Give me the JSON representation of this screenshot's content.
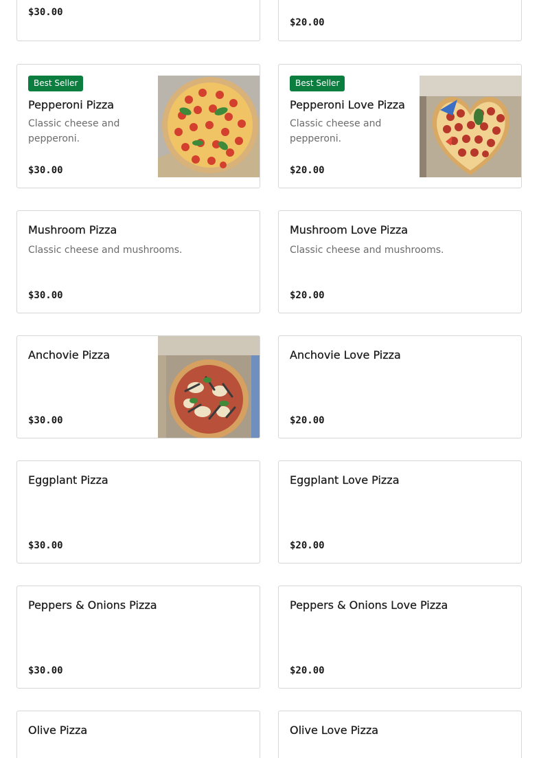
{
  "items": [
    {
      "price": "$30.00"
    },
    {
      "price": "$20.00"
    },
    {
      "badge": "Best Seller",
      "name": "Pepperoni Pizza",
      "desc": "Classic cheese and pepperoni.",
      "price": "$30.00",
      "image": "pepperoni-pizza-photo"
    },
    {
      "badge": "Best Seller",
      "name": "Pepperoni Love Pizza",
      "desc": "Classic cheese and pepperoni.",
      "price": "$20.00",
      "image": "heart-pepperoni-pizza-photo"
    },
    {
      "name": "Mushroom Pizza",
      "desc": "Classic cheese and mushrooms.",
      "price": "$30.00"
    },
    {
      "name": "Mushroom Love Pizza",
      "desc": "Classic cheese and mushrooms.",
      "price": "$20.00"
    },
    {
      "name": "Anchovie Pizza",
      "price": "$30.00",
      "image": "anchovie-pizza-photo"
    },
    {
      "name": "Anchovie Love Pizza",
      "price": "$20.00"
    },
    {
      "name": "Eggplant Pizza",
      "price": "$30.00"
    },
    {
      "name": "Eggplant Love Pizza",
      "price": "$20.00"
    },
    {
      "name": "Peppers & Onions Pizza",
      "price": "$30.00"
    },
    {
      "name": "Peppers & Onions Love Pizza",
      "price": "$20.00"
    },
    {
      "name": "Olive Pizza"
    },
    {
      "name": "Olive Love Pizza"
    }
  ],
  "colors": {
    "badge": "#0b7d3e",
    "border": "#d6d6d6",
    "text": "#191919",
    "muted": "#6b6b6b"
  }
}
